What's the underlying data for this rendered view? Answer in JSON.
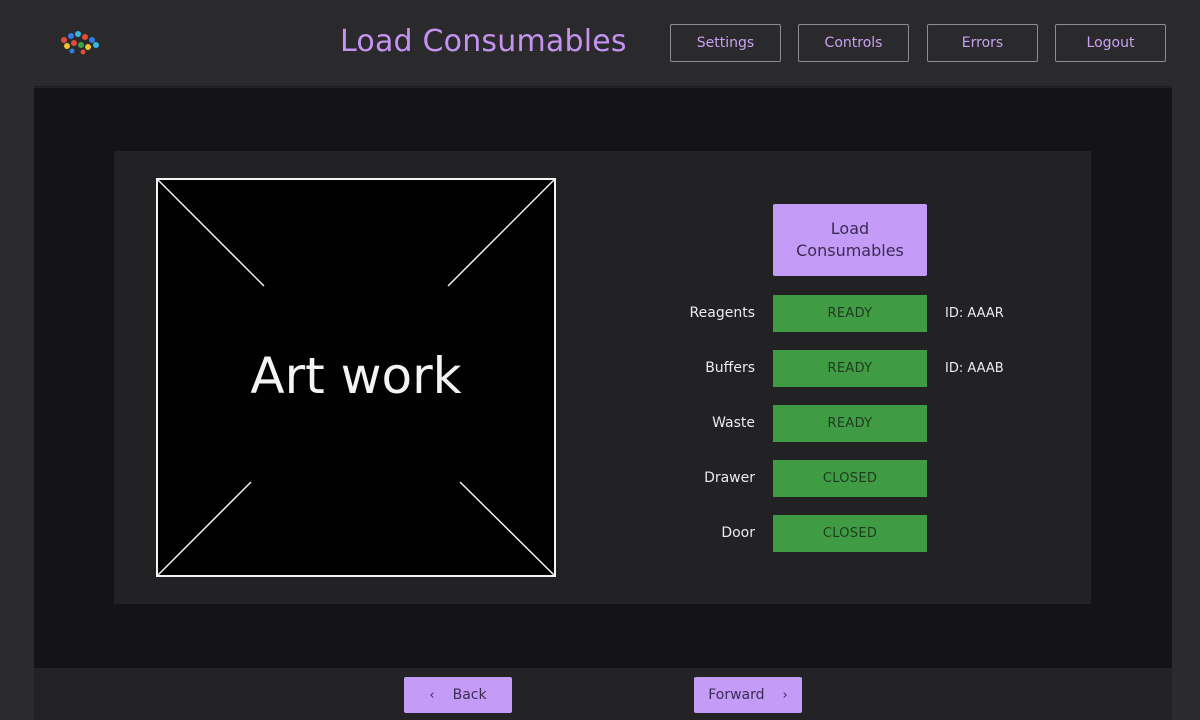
{
  "header": {
    "title": "Load Consumables",
    "buttons": {
      "settings": "Settings",
      "controls": "Controls",
      "errors": "Errors",
      "logout": "Logout"
    }
  },
  "artwork": {
    "label": "Art work"
  },
  "load_button": {
    "line1": "Load",
    "line2": "Consumables"
  },
  "rows": [
    {
      "label": "Reagents",
      "status": "READY",
      "id": "ID: AAAR"
    },
    {
      "label": "Buffers",
      "status": "READY",
      "id": "ID: AAAB"
    },
    {
      "label": "Waste",
      "status": "READY",
      "id": ""
    },
    {
      "label": "Drawer",
      "status": "CLOSED",
      "id": ""
    },
    {
      "label": "Door",
      "status": "CLOSED",
      "id": ""
    }
  ],
  "footer": {
    "back": "Back",
    "forward": "Forward"
  },
  "colors": {
    "accent": "#c49cf7",
    "status_ok": "#3f9c44",
    "title": "#c592f2"
  },
  "icons": {
    "logo": "dots-logo",
    "back": "chevron-left-icon",
    "forward": "chevron-right-icon"
  }
}
